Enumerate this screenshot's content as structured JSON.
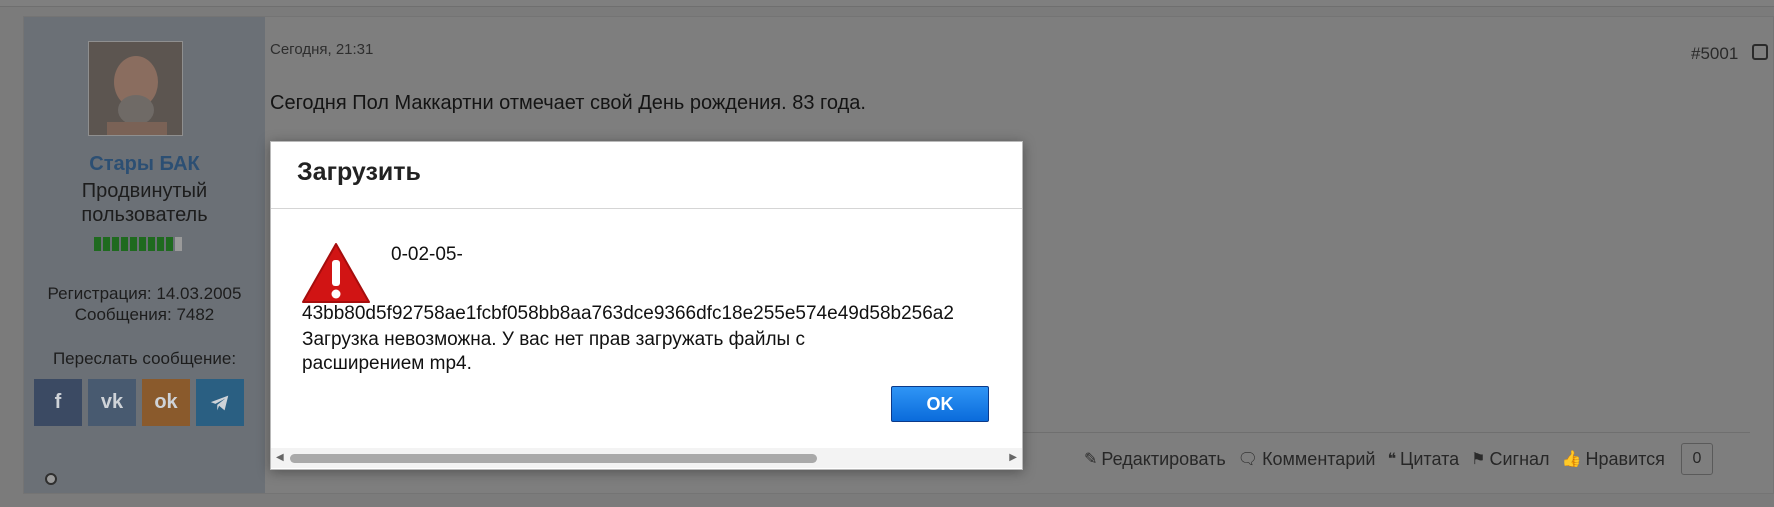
{
  "post": {
    "author": {
      "name": "Стары БАК",
      "rank_line1": "Продвинутый",
      "rank_line2": "пользователь",
      "registration": "Регистрация: 14.03.2005",
      "messages": "Сообщения: 7482",
      "reputation": {
        "filled": 9,
        "total": 10
      }
    },
    "share_label": "Переслать сообщение:",
    "share_icons": [
      "facebook-icon",
      "vk-icon",
      "odnoklassniki-icon",
      "telegram-icon"
    ],
    "share_glyphs": {
      "fb": "f",
      "vk": "vk",
      "ok": "ok"
    },
    "date": "Сегодня, 21:31",
    "number": "#5001",
    "text": "Сегодня Пол Маккартни отмечает свой День рождения. 83 года.",
    "actions": {
      "edit": "Редактировать",
      "comment": "Комментарий",
      "quote": "Цитата",
      "report": "Сигнал",
      "like": "Нравится",
      "like_count": "0"
    }
  },
  "modal": {
    "title": "Загрузить",
    "file_id_line1": "0-02-05-",
    "file_id_line2": "43bb80d5f92758ae1fcbf058bb8aa763dce9366dfc18e255e574e49d58b256a2",
    "message": "Загрузка невозможна. У вас нет прав загружать файлы с расширением mp4.",
    "ok_label": "OK"
  }
}
